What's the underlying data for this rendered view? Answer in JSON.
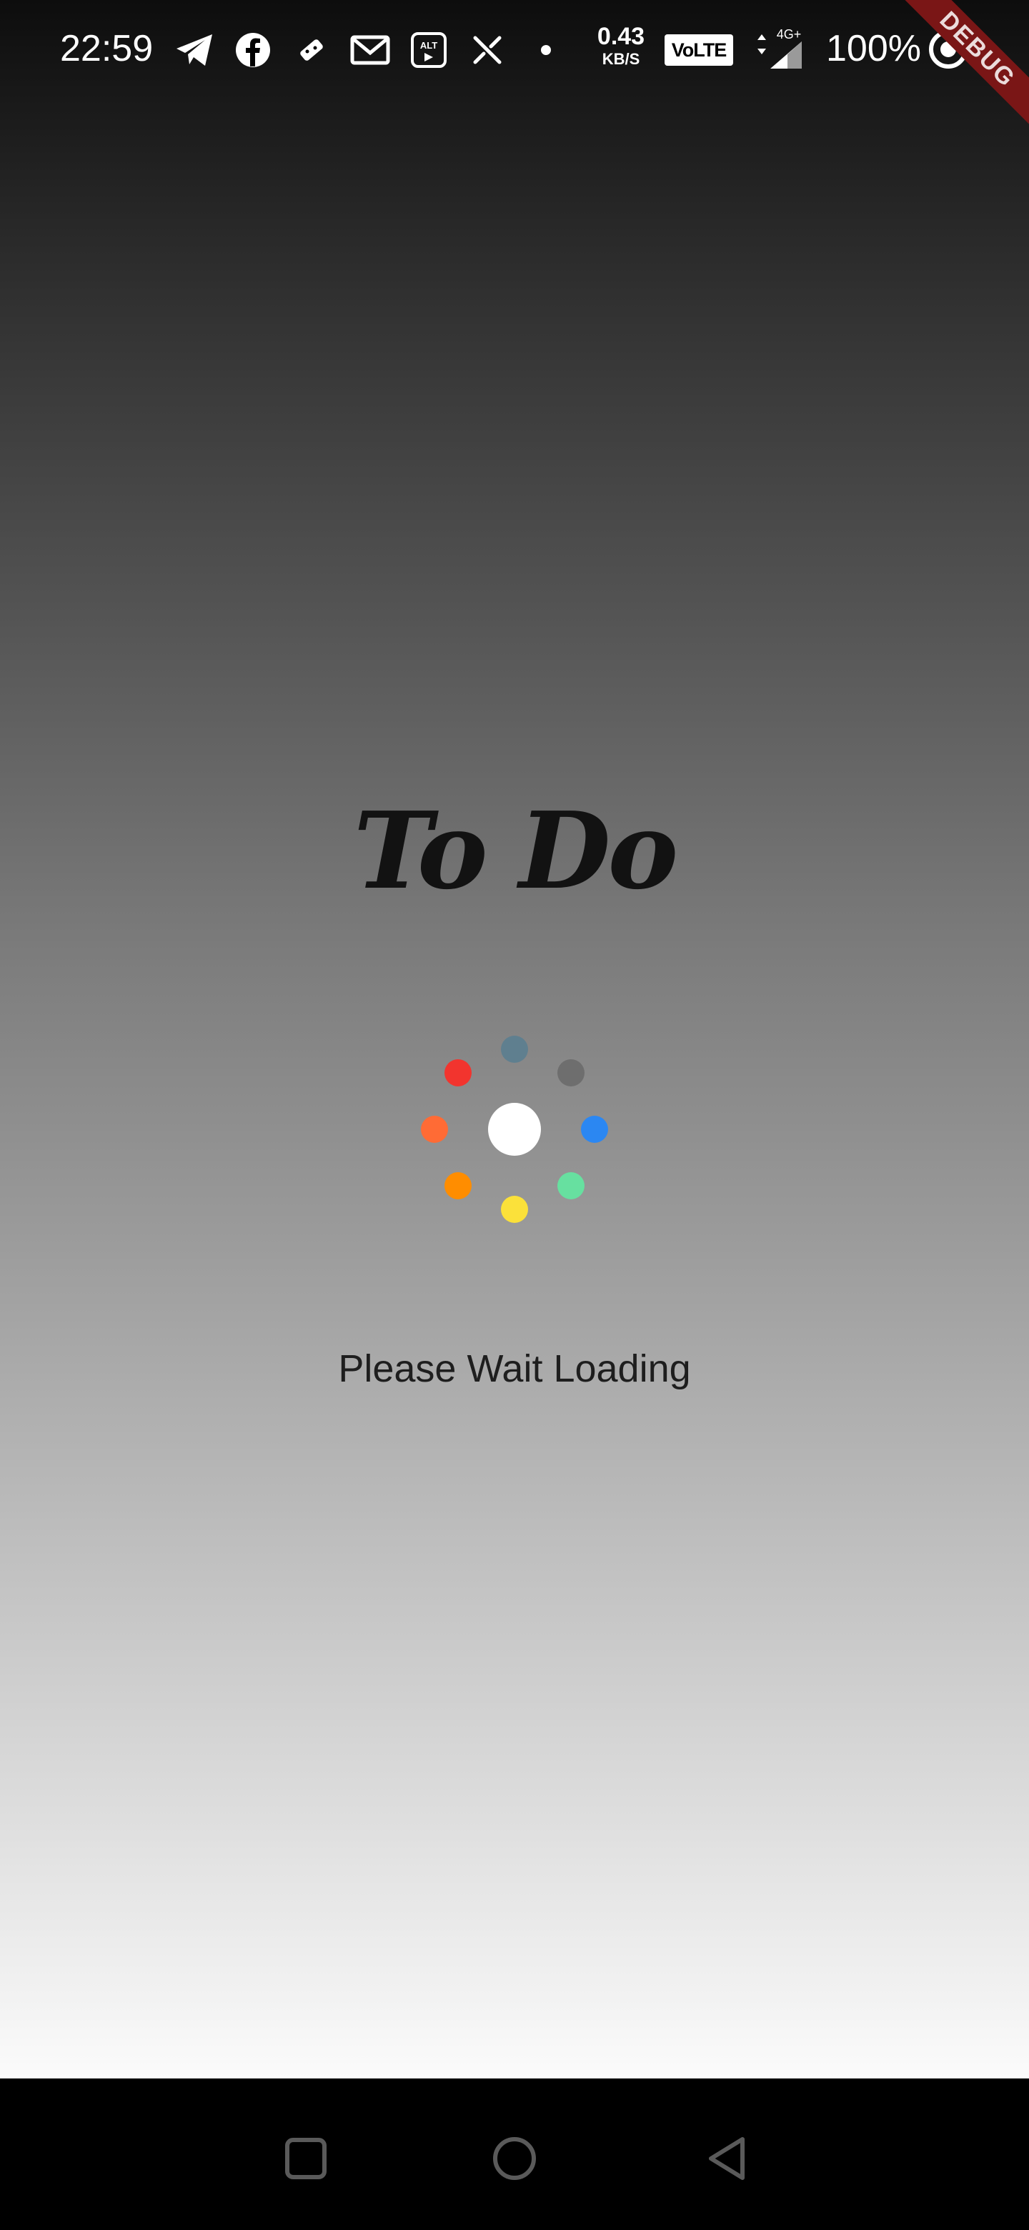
{
  "status_bar": {
    "time": "22:59",
    "notification_icons": [
      "telegram-icon",
      "facebook-icon",
      "game-controller-icon",
      "gmail-icon",
      "alt-balaji-icon",
      "x-icon",
      "dot-icon"
    ],
    "net_speed_value": "0.43",
    "net_speed_unit": "KB/S",
    "volte_label": "VoLTE",
    "network_type": "4G+",
    "battery_percent": "100%",
    "debug_banner": "DEBUG"
  },
  "app": {
    "title": "To Do",
    "loading_text": "Please Wait Loading",
    "spinner": {
      "center_color": "#ffffff",
      "dot_colors": [
        "#5f7f8f",
        "#6e6e6e",
        "#2b87f2",
        "#67e0a0",
        "#fbe13a",
        "#ff8d00",
        "#ff6b35",
        "#f2342e"
      ]
    }
  },
  "nav_bar": {
    "buttons": [
      "recents-icon",
      "home-icon",
      "back-icon"
    ]
  }
}
